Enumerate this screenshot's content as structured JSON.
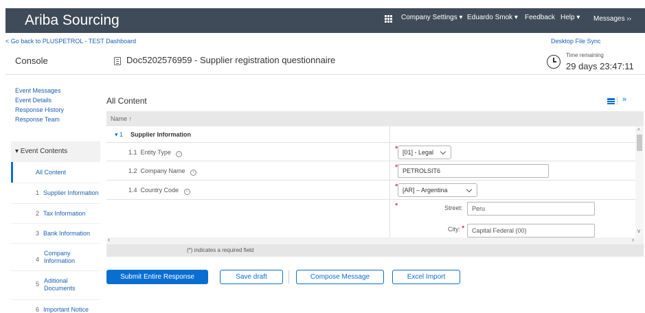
{
  "header": {
    "brand": "Ariba Sourcing",
    "company_settings": "Company Settings ▾",
    "user": "Eduardo Smok ▾",
    "feedback": "Feedback",
    "help": "Help ▾",
    "messages": "Messages ›› "
  },
  "subheader": {
    "back_link": "< Go back to PLUSPETROL - TEST Dashboard",
    "desktop_sync": "Desktop File Sync"
  },
  "title_bar": {
    "console": "Console",
    "doc_title": "Doc5202576959 - Supplier registration questionnaire",
    "time_label": "Time remaining",
    "time_value": "29 days 23:47:11"
  },
  "sidebar": {
    "links": [
      "Event Messages",
      "Event Details",
      "Response History",
      "Response Team"
    ],
    "event_contents": "▾ Event Contents",
    "items": [
      {
        "num": "",
        "label": "All Content"
      },
      {
        "num": "1",
        "label": "Supplier Information"
      },
      {
        "num": "2",
        "label": "Tax Information"
      },
      {
        "num": "3",
        "label": "Bank Information"
      },
      {
        "num": "4",
        "label": "Company Information"
      },
      {
        "num": "5",
        "label": "Aditional Documents"
      },
      {
        "num": "6",
        "label": "Important Notice"
      }
    ]
  },
  "main": {
    "title": "All Content",
    "col_name": "Name ↑",
    "section": {
      "num": "▾ 1",
      "label": "Supplier Information"
    },
    "rows": [
      {
        "num": "1.1",
        "label": "Entity Type",
        "value": "[01] - Legal"
      },
      {
        "num": "1.2",
        "label": "Company Name",
        "value": "PETROLSIT6"
      },
      {
        "num": "1.4",
        "label": "Country Code",
        "value": "[AR] – Argentina"
      }
    ],
    "street_label": "Street:",
    "street_value": "Peru",
    "city_label": "City:",
    "city_value": "Capital Federal (00)",
    "required_note": "(*) indicates a required field"
  },
  "buttons": {
    "submit": "Submit Entire Response",
    "save": "Save draft",
    "compose": "Compose Message",
    "excel": "Excel Import"
  }
}
